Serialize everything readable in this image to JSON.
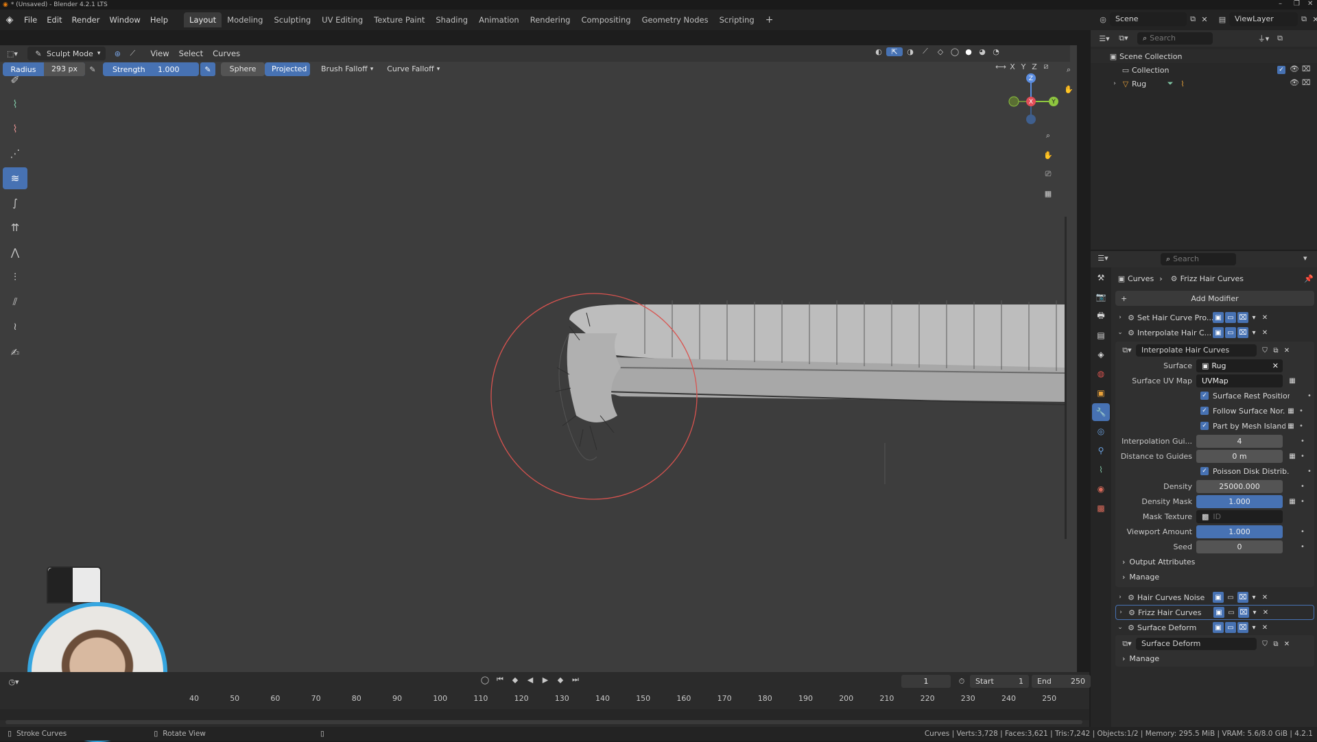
{
  "window": {
    "title": "* (Unsaved) - Blender 4.2.1 LTS",
    "controls": [
      "–",
      "❐",
      "✕"
    ]
  },
  "menu": [
    "File",
    "Edit",
    "Render",
    "Window",
    "Help"
  ],
  "workspaces": [
    {
      "label": "Layout",
      "active": true
    },
    {
      "label": "Modeling"
    },
    {
      "label": "Sculpting"
    },
    {
      "label": "UV Editing"
    },
    {
      "label": "Texture Paint"
    },
    {
      "label": "Shading"
    },
    {
      "label": "Animation"
    },
    {
      "label": "Rendering"
    },
    {
      "label": "Compositing"
    },
    {
      "label": "Geometry Nodes"
    },
    {
      "label": "Scripting"
    }
  ],
  "scene": {
    "label": "Scene",
    "viewlayer": "ViewLayer"
  },
  "viewport_header": {
    "mode": "Sculpt Mode",
    "menus": [
      "View",
      "Select",
      "Curves"
    ],
    "axes": [
      "X",
      "Y",
      "Z"
    ]
  },
  "tool_options": {
    "radius_label": "Radius",
    "radius_value": "293 px",
    "strength_label": "Strength",
    "strength_value": "1.000",
    "sphere": "Sphere",
    "projected": "Projected",
    "brush_falloff": "Brush Falloff",
    "curve_falloff": "Curve Falloff"
  },
  "gizmo": {
    "z": "Z",
    "x": "X",
    "y": "Y"
  },
  "outliner": {
    "search_placeholder": "Search",
    "root": "Scene Collection",
    "collection": "Collection",
    "object": "Rug"
  },
  "properties": {
    "search_placeholder": "Search",
    "breadcrumb_object": "Curves",
    "breadcrumb_modifier": "Frizz Hair Curves",
    "add_modifier": "Add Modifier",
    "modifiers_collapsed_top": [
      "Set Hair Curve Pro...",
      "Interpolate Hair C..."
    ],
    "interp": {
      "title": "Interpolate Hair Curves",
      "surface_label": "Surface",
      "surface_value": "Rug",
      "uvmap_label": "Surface UV Map",
      "uvmap_value": "UVMap",
      "checks": [
        "Surface Rest Position",
        "Follow Surface Nor...",
        "Part by Mesh Islands"
      ],
      "interp_guides_label": "Interpolation Gui...",
      "interp_guides_value": "4",
      "distance_label": "Distance to Guides",
      "distance_value": "0 m",
      "poisson_label": "Poisson Disk Distrib...",
      "density_label": "Density",
      "density_value": "25000.000",
      "density_mask_label": "Density Mask",
      "density_mask_value": "1.000",
      "mask_texture_label": "Mask Texture",
      "mask_texture_placeholder": "ID",
      "viewport_amount_label": "Viewport Amount",
      "viewport_amount_value": "1.000",
      "seed_label": "Seed",
      "seed_value": "0",
      "output_attributes": "Output Attributes",
      "manage": "Manage"
    },
    "modifiers_bottom": [
      "Hair Curves Noise",
      "Frizz Hair Curves",
      "Surface Deform"
    ],
    "surface_deform_sub": "Surface Deform",
    "manage2": "Manage"
  },
  "timeline": {
    "current_frame": "1",
    "start_label": "Start",
    "start": "1",
    "end_label": "End",
    "end": "250",
    "ticks": [
      "40",
      "50",
      "60",
      "70",
      "80",
      "90",
      "100",
      "110",
      "120",
      "130",
      "140",
      "150",
      "160",
      "170",
      "180",
      "190",
      "200",
      "210",
      "220",
      "230",
      "240",
      "250"
    ]
  },
  "status": {
    "left1": "Stroke Curves",
    "left2": "Rotate View",
    "right": "Curves | Verts:3,728 | Faces:3,621 | Tris:7,242 | Objects:1/2 | Memory: 295.5 MiB | VRAM: 5.6/8.0 GiB | 4.2.1"
  },
  "colors": {
    "accent": "#4772b3",
    "brush_circle": "#d9534f",
    "viewport_bg": "#3d3d3d"
  }
}
